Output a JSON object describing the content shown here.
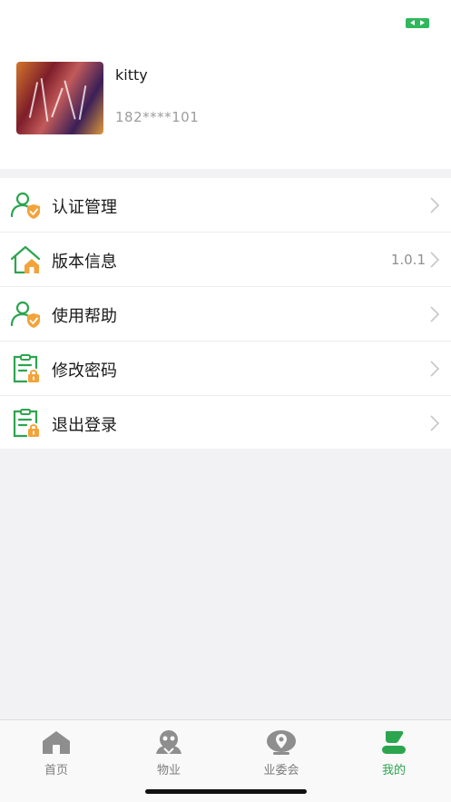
{
  "profile": {
    "name": "kitty",
    "phone": "182****101"
  },
  "menu": {
    "items": [
      {
        "label": "认证管理",
        "value": "",
        "icon": "user-shield-icon"
      },
      {
        "label": "版本信息",
        "value": "1.0.1",
        "icon": "house-icon"
      },
      {
        "label": "使用帮助",
        "value": "",
        "icon": "user-shield-icon"
      },
      {
        "label": "修改密码",
        "value": "",
        "icon": "clipboard-lock-icon"
      },
      {
        "label": "退出登录",
        "value": "",
        "icon": "clipboard-lock-icon"
      }
    ]
  },
  "tabbar": {
    "tabs": [
      {
        "label": "首页",
        "icon": "home-icon",
        "active": false
      },
      {
        "label": "物业",
        "icon": "property-icon",
        "active": false
      },
      {
        "label": "业委会",
        "icon": "committee-icon",
        "active": false
      },
      {
        "label": "我的",
        "icon": "mine-icon",
        "active": true
      }
    ]
  },
  "colors": {
    "accent_green": "#2ca54f",
    "badge_orange": "#f2a33a",
    "inactive_gray": "#7d7d7d"
  }
}
